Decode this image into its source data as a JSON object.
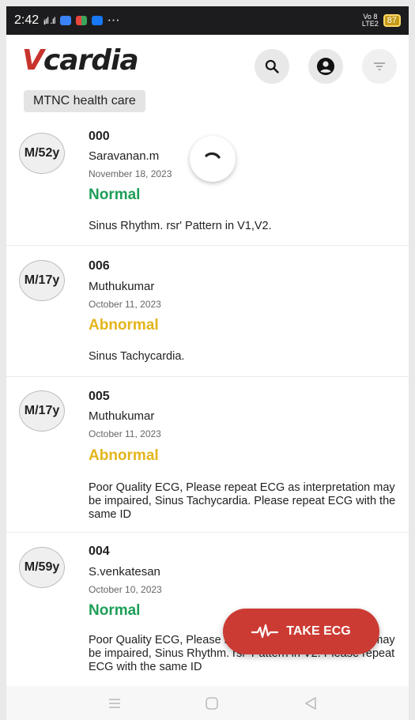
{
  "status_bar": {
    "time": "2:42",
    "signal": "ᵢᵢıl .ıl",
    "more": "···",
    "volte": "Vo 8\nLTE2",
    "battery": "87"
  },
  "app": {
    "logo_initial": "V",
    "logo_rest": "cardia",
    "brand_color": "#c8332d"
  },
  "filter_chip": "MTNC health care",
  "records": [
    {
      "avatar": "M/52y",
      "id": "000",
      "name": "Saravanan.m",
      "date": "November 18, 2023",
      "status": "Normal",
      "status_color": "#1e9e57",
      "interpretation": "Sinus Rhythm. rsr' Pattern in V1,V2."
    },
    {
      "avatar": "M/17y",
      "id": "006",
      "name": "Muthukumar",
      "date": "October 11, 2023",
      "status": "Abnormal",
      "status_color": "#e3b51b",
      "interpretation": "Sinus Tachycardia."
    },
    {
      "avatar": "M/17y",
      "id": "005",
      "name": "Muthukumar",
      "date": "October 11, 2023",
      "status": "Abnormal",
      "status_color": "#e3b51b",
      "interpretation": "Poor Quality ECG, Please repeat ECG as interpretation may be impaired, Sinus Tachycardia. Please repeat ECG with the same ID"
    },
    {
      "avatar": "M/59y",
      "id": "004",
      "name": "S.venkatesan",
      "date": "October 10, 2023",
      "status": "Normal",
      "status_color": "#1e9e57",
      "interpretation": "Poor Quality ECG, Please repeat ECG as interpretation may be impaired, Sinus Rhythm. rsr' Pattern in V2. Please repeat ECG with the same ID"
    }
  ],
  "fab": {
    "label": "TAKE ECG",
    "icon": "ecg-wave-icon",
    "color": "#cc3b33"
  },
  "icons": {
    "search": "search-icon",
    "account": "account-icon",
    "filter": "filter-icon",
    "nav_recents": "recents-icon",
    "nav_home": "home-icon",
    "nav_back": "back-icon"
  }
}
